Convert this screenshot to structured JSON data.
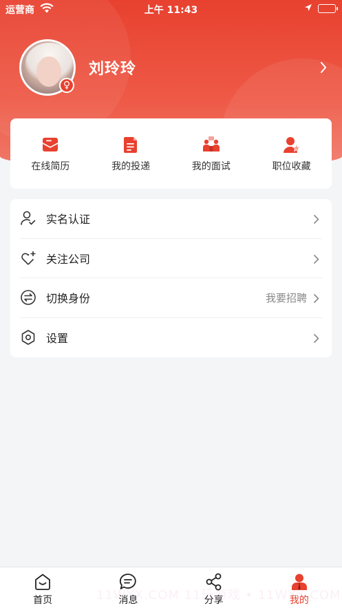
{
  "status_bar": {
    "carrier": "运营商",
    "time": "上午 11:43"
  },
  "profile": {
    "name": "刘玲玲",
    "gender_symbol": "♀"
  },
  "quick_actions": [
    {
      "label": "在线简历",
      "icon": "resume-mail-icon"
    },
    {
      "label": "我的投递",
      "icon": "document-icon"
    },
    {
      "label": "我的面试",
      "icon": "interview-icon"
    },
    {
      "label": "职位收藏",
      "icon": "favorite-person-icon"
    }
  ],
  "menu": [
    {
      "label": "实名认证",
      "value": "",
      "icon": "user-verify-icon"
    },
    {
      "label": "关注公司",
      "value": "",
      "icon": "heart-plus-icon"
    },
    {
      "label": "切换身份",
      "value": "我要招聘",
      "icon": "switch-icon"
    },
    {
      "label": "设置",
      "value": "",
      "icon": "hexagon-settings-icon"
    }
  ],
  "tabs": [
    {
      "label": "首页",
      "icon": "home-icon",
      "active": false
    },
    {
      "label": "消息",
      "icon": "message-icon",
      "active": false
    },
    {
      "label": "分享",
      "icon": "share-icon",
      "active": false
    },
    {
      "label": "我的",
      "icon": "profile-icon",
      "active": true
    }
  ],
  "watermark": "11WYX.COM 11玩游戏 • 11WYX.COM",
  "colors": {
    "brand": "#e8412f",
    "background": "#f4f5f7",
    "text_secondary": "#888888"
  }
}
